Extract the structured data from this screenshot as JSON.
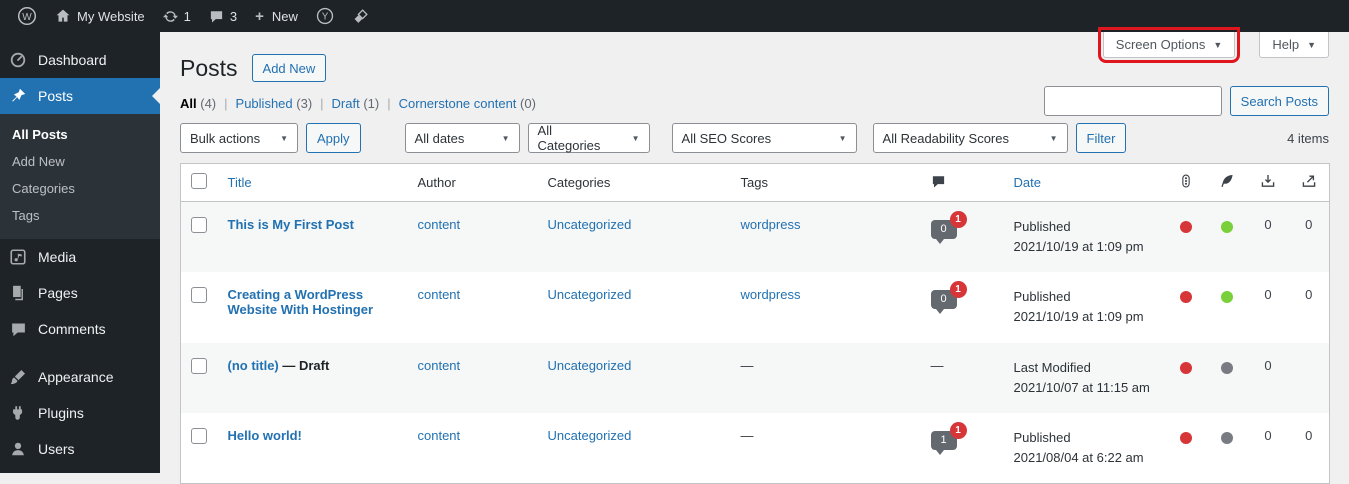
{
  "accent_color": "#2271b1",
  "annotation_color": "#e0161f",
  "admin_bar": {
    "site_name": "My Website",
    "update_count": "1",
    "comment_count": "3",
    "new_label": "New"
  },
  "sidebar": {
    "items": [
      {
        "label": "Dashboard"
      },
      {
        "label": "Posts"
      },
      {
        "label": "Media"
      },
      {
        "label": "Pages"
      },
      {
        "label": "Comments"
      },
      {
        "label": "Appearance"
      },
      {
        "label": "Plugins"
      },
      {
        "label": "Users"
      }
    ],
    "posts_submenu": [
      {
        "label": "All Posts"
      },
      {
        "label": "Add New"
      },
      {
        "label": "Categories"
      },
      {
        "label": "Tags"
      }
    ]
  },
  "header": {
    "page_title": "Posts",
    "add_new_button": "Add New",
    "screen_options_button": "Screen Options",
    "help_button": "Help"
  },
  "views": [
    {
      "label": "All",
      "count": "(4)"
    },
    {
      "label": "Published",
      "count": "(3)"
    },
    {
      "label": "Draft",
      "count": "(1)"
    },
    {
      "label": "Cornerstone content",
      "count": "(0)"
    }
  ],
  "search": {
    "value": "",
    "button_label": "Search Posts"
  },
  "filters": {
    "bulk_actions": "Bulk actions",
    "apply_button": "Apply",
    "all_dates": "All dates",
    "all_categories": "All Categories",
    "all_seo_scores": "All SEO Scores",
    "all_readability_scores": "All Readability Scores",
    "filter_button": "Filter",
    "items_count": "4 items"
  },
  "table": {
    "headers": {
      "title": "Title",
      "author": "Author",
      "categories": "Categories",
      "tags": "Tags",
      "date": "Date"
    },
    "rows": [
      {
        "title": "This is My First Post",
        "author": "content",
        "categories": "Uncategorized",
        "tags": "wordpress",
        "comments_approved": "0",
        "comments_pending": "1",
        "status": "Published",
        "date": "2021/10/19 at 1:09 pm",
        "seo_score_color": "#d63638",
        "readability_score_color": "#7ad03a",
        "internal_links": "0",
        "outgoing_links": "0"
      },
      {
        "title": "Creating a WordPress Website With Hostinger",
        "author": "content",
        "categories": "Uncategorized",
        "tags": "wordpress",
        "comments_approved": "0",
        "comments_pending": "1",
        "status": "Published",
        "date": "2021/10/19 at 1:09 pm",
        "seo_score_color": "#d63638",
        "readability_score_color": "#7ad03a",
        "internal_links": "0",
        "outgoing_links": "0"
      },
      {
        "title": "(no title)",
        "title_suffix": " — Draft",
        "author": "content",
        "categories": "Uncategorized",
        "tags": "—",
        "comments": "—",
        "status": "Last Modified",
        "date": "2021/10/07 at 11:15 am",
        "seo_score_color": "#d63638",
        "readability_score_color": "#787c82",
        "internal_links": "0",
        "outgoing_links": ""
      },
      {
        "title": "Hello world!",
        "author": "content",
        "categories": "Uncategorized",
        "tags": "—",
        "comments_approved": "1",
        "comments_pending": "1",
        "status": "Published",
        "date": "2021/08/04 at 6:22 am",
        "seo_score_color": "#d63638",
        "readability_score_color": "#787c82",
        "internal_links": "0",
        "outgoing_links": "0"
      }
    ]
  }
}
